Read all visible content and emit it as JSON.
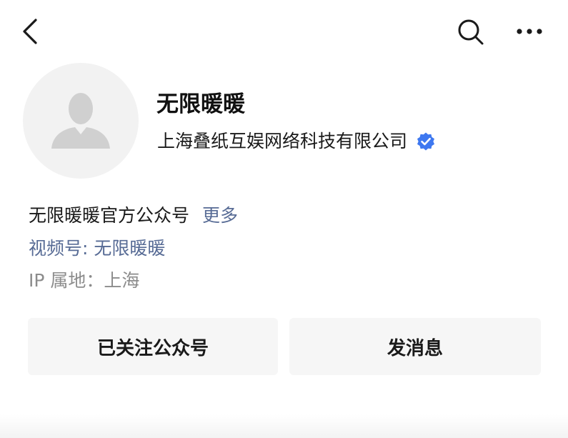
{
  "header": {
    "back_icon": "chevron-left-icon",
    "search_icon": "search-icon",
    "more_icon": "ellipsis-icon"
  },
  "profile": {
    "avatar_icon": "default-avatar-icon",
    "name": "无限暖暖",
    "company": "上海叠纸互娱网络科技有限公司",
    "verified_icon": "verified-badge-icon",
    "verified_color": "#3e78f0",
    "intro": "无限暖暖官方公众号",
    "more_label": "更多",
    "channels": "视频号: 无限暖暖",
    "ip_location": "IP 属地：上海"
  },
  "actions": {
    "followed_label": "已关注公众号",
    "message_label": "发消息"
  },
  "colors": {
    "link": "#576b95",
    "muted": "#8c8c8c",
    "button_bg": "#f6f6f6"
  }
}
